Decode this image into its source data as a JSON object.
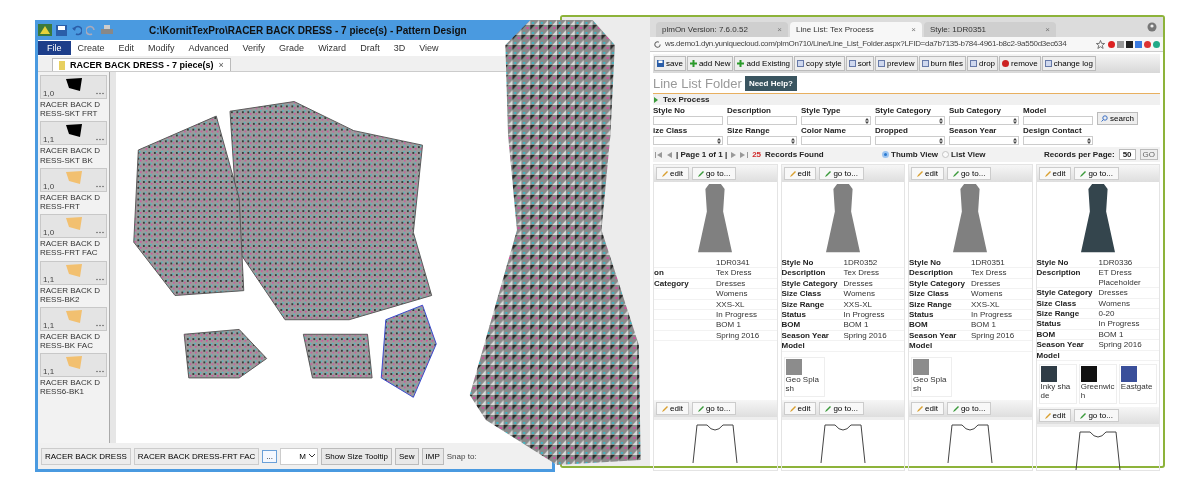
{
  "pattern_window": {
    "title": "C:\\KornitTexPro\\RACER BACK DRESS  -  7 piece(s) - Pattern Design",
    "menu": [
      {
        "label": "File",
        "selected": true
      },
      {
        "label": "Create",
        "selected": false
      },
      {
        "label": "Edit",
        "selected": false
      },
      {
        "label": "Modify",
        "selected": false
      },
      {
        "label": "Advanced",
        "selected": false
      },
      {
        "label": "Verify",
        "selected": false
      },
      {
        "label": "Grade",
        "selected": false
      },
      {
        "label": "Wizard",
        "selected": false
      },
      {
        "label": "Draft",
        "selected": false
      },
      {
        "label": "3D",
        "selected": false
      },
      {
        "label": "View",
        "selected": false
      }
    ],
    "doc_tab": {
      "label": "RACER BACK DRESS  -  7 piece(s)",
      "close": "×"
    },
    "pieces": [
      {
        "quantity": "1,0",
        "name": "RACER BACK DRESS-SKT FRT",
        "color": "#000000"
      },
      {
        "quantity": "1,1",
        "name": "RACER BACK DRESS-SKT BK",
        "color": "#000000"
      },
      {
        "quantity": "1,0",
        "name": "RACER BACK DRESS-FRT",
        "color": "#f2c070"
      },
      {
        "quantity": "1,0",
        "name": "RACER BACK DRESS-FRT FAC",
        "color": "#f2c070"
      },
      {
        "quantity": "1,1",
        "name": "RACER BACK DRESS-BK2",
        "color": "#f2c070"
      },
      {
        "quantity": "1,1",
        "name": "RACER BACK DRESS-BK FAC",
        "color": "#f2c070"
      },
      {
        "quantity": "1,1",
        "name": "RACER BACK DRESS6-BK1",
        "color": "#f2c070"
      }
    ],
    "status_bar": {
      "style_field": "RACER BACK DRESS",
      "piece_field": "RACER BACK DRESS-FRT FAC",
      "browse_button": "...",
      "size_select": "M",
      "buttons": [
        "Show Size Tooltip",
        "Sew",
        "IMP"
      ],
      "snap_label": "Snap to:"
    }
  },
  "browser": {
    "tabs": [
      {
        "label": "plmOn Version: 7.6.0.52",
        "close": "×",
        "selected": false
      },
      {
        "label": "Line List: Tex Process",
        "close": "×",
        "selected": true
      },
      {
        "label": "Style: 1DR0351",
        "close": "×",
        "selected": false
      }
    ],
    "url": "ws.demo1.dyn.yuniquecloud.com/plmOn710/Line/Line_List_Folder.aspx?LFID=da7b7135-b784-4961-b8c2-9a550d3ec634",
    "toolbar": [
      {
        "label": "save",
        "kind": "save"
      },
      {
        "label": "add New",
        "kind": "add"
      },
      {
        "label": "add Existing",
        "kind": "add"
      },
      {
        "label": "copy style",
        "kind": "other"
      },
      {
        "label": "sort",
        "kind": "other"
      },
      {
        "label": "preview",
        "kind": "other"
      },
      {
        "label": "burn files",
        "kind": "other"
      },
      {
        "label": "drop",
        "kind": "other"
      },
      {
        "label": "remove",
        "kind": "remove"
      },
      {
        "label": "change log",
        "kind": "other"
      }
    ],
    "heading": "Line List Folder",
    "help_button": "Need Help?",
    "section": "Tex Process",
    "filters": [
      [
        {
          "label": "Style No",
          "kind": "text"
        },
        {
          "label": "Description",
          "kind": "text"
        },
        {
          "label": "Style Type",
          "kind": "select"
        },
        {
          "label": "Style Category",
          "kind": "select"
        },
        {
          "label": "Sub Category",
          "kind": "select"
        },
        {
          "label": "Model",
          "kind": "text"
        }
      ],
      [
        {
          "label": "ize Class",
          "kind": "select"
        },
        {
          "label": "Size Range",
          "kind": "select"
        },
        {
          "label": "Color Name",
          "kind": "text"
        },
        {
          "label": "Dropped",
          "kind": "select"
        },
        {
          "label": "Season Year",
          "kind": "select"
        },
        {
          "label": "Design Contact",
          "kind": "select"
        }
      ]
    ],
    "search_button": "search",
    "pager": {
      "page": "| Page 1 of 1 |",
      "count": "25",
      "found": "Records Found",
      "views": [
        {
          "label": "Thumb View",
          "selected": true
        },
        {
          "label": "List View",
          "selected": false
        }
      ],
      "per_page_label": "Records per Page:",
      "per_page": "50",
      "go": "GO"
    },
    "cards": [
      {
        "buttons": [
          "edit",
          "go to..."
        ],
        "fields": [
          {
            "value": "1DR0341"
          },
          {
            "label": "on",
            "value": "Tex Dress"
          },
          {
            "label": "Category",
            "value": "Dresses"
          },
          {
            "value": "Womens"
          },
          {
            "value": "XXS-XL"
          },
          {
            "value": "In Progress"
          },
          {
            "value": "BOM 1"
          },
          {
            "value": "Spring 2016"
          }
        ],
        "footer_buttons": [
          "edit",
          "go to..."
        ]
      },
      {
        "buttons": [
          "edit",
          "go to..."
        ],
        "fields": [
          {
            "label": "Style No",
            "value": "1DR0352"
          },
          {
            "label": "Description",
            "value": "Tex Dress"
          },
          {
            "label": "Style Category",
            "value": "Dresses"
          },
          {
            "label": "Size Class",
            "value": "Womens"
          },
          {
            "label": "Size Range",
            "value": "XXS-XL"
          },
          {
            "label": "Status",
            "value": "In Progress"
          },
          {
            "label": "BOM",
            "value": "BOM 1"
          },
          {
            "label": "Season Year",
            "value": "Spring 2016"
          },
          {
            "label": "Model"
          }
        ],
        "swatches": [
          {
            "name": "Geo Splash",
            "color": "#8c8c8c"
          }
        ],
        "footer_buttons": [
          "edit",
          "go to..."
        ]
      },
      {
        "buttons": [
          "edit",
          "go to..."
        ],
        "fields": [
          {
            "label": "Style No",
            "value": "1DR0351"
          },
          {
            "label": "Description",
            "value": "Tex Dress"
          },
          {
            "label": "Style Category",
            "value": "Dresses"
          },
          {
            "label": "Size Class",
            "value": "Womens"
          },
          {
            "label": "Size Range",
            "value": "XXS-XL"
          },
          {
            "label": "Status",
            "value": "In Progress"
          },
          {
            "label": "BOM",
            "value": "BOM 1"
          },
          {
            "label": "Season Year",
            "value": "Spring 2016"
          },
          {
            "label": "Model"
          }
        ],
        "swatches": [
          {
            "name": "Geo Splash",
            "color": "#8c8c8c"
          }
        ],
        "footer_buttons": [
          "edit",
          "go to..."
        ]
      },
      {
        "buttons": [
          "edit",
          "go to..."
        ],
        "fields": [
          {
            "label": "Style No",
            "value": "1DR0336"
          },
          {
            "label": "Description",
            "value": "ET Dress Placeholder"
          },
          {
            "label": "Style Category",
            "value": "Dresses"
          },
          {
            "label": "Size Class",
            "value": "Womens"
          },
          {
            "label": "Size Range",
            "value": "0-20"
          },
          {
            "label": "Status",
            "value": "In Progress"
          },
          {
            "label": "BOM",
            "value": "BOM 1"
          },
          {
            "label": "Season Year",
            "value": "Spring 2016"
          },
          {
            "label": "Model"
          }
        ],
        "swatches": [
          {
            "name": "Inky shade",
            "color": "#2f3c46"
          },
          {
            "name": "Greenwich",
            "color": "#111111"
          },
          {
            "name": "Eastgate",
            "color": "#3a4f9a"
          }
        ],
        "footer_buttons": [
          "edit",
          "go to..."
        ]
      }
    ]
  }
}
